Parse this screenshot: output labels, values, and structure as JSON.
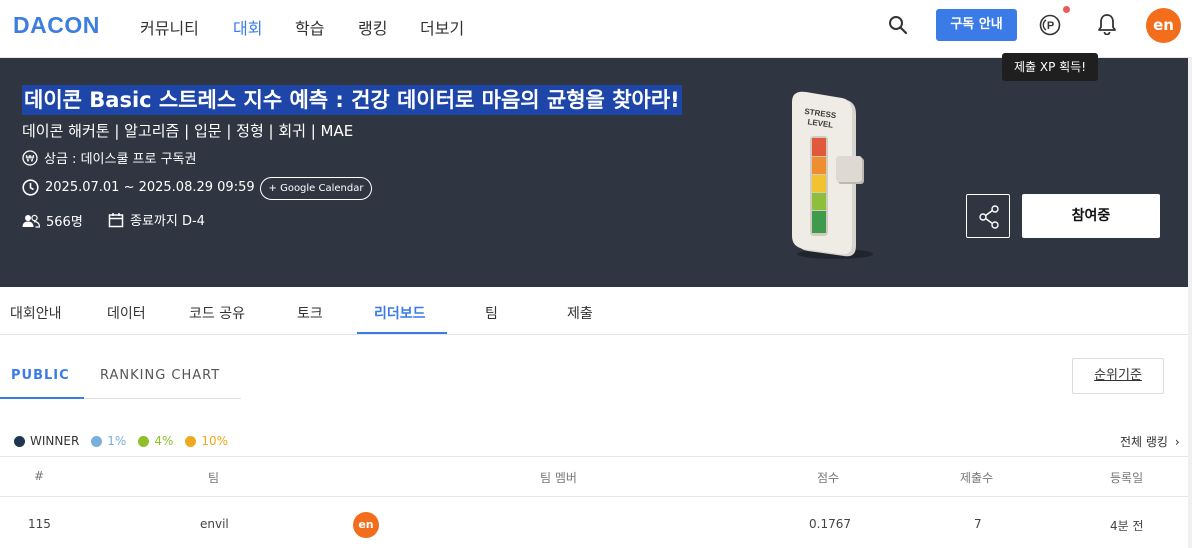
{
  "brand": {
    "logo": "DACON"
  },
  "nav": {
    "items": [
      {
        "label": "커뮤니티",
        "active": false
      },
      {
        "label": "대회",
        "active": true
      },
      {
        "label": "학습",
        "active": false
      },
      {
        "label": "랭킹",
        "active": false
      },
      {
        "label": "더보기",
        "active": false
      }
    ],
    "subscribe_label": "구독 안내",
    "avatar_text": "en",
    "tooltip": "제출 XP 획득!"
  },
  "hero": {
    "title": "데이콘 Basic 스트레스 지수 예측 : 건강 데이터로 마음의 균형을 찾아라!",
    "tags": "데이콘 해커톤 | 알고리즘 | 입문 | 정형 | 회귀 | MAE",
    "prize": "상금 : 데이스쿨 프로 구독권",
    "period": "2025.07.01 ~ 2025.08.29 09:59",
    "calendar_button": "+ Google Calendar",
    "participants": "566명",
    "deadline": "종료까지 D-4",
    "image_label_1": "STRESS",
    "image_label_2": "LEVEL",
    "join_label": "참여중"
  },
  "tabs": [
    {
      "label": "대회안내",
      "active": false
    },
    {
      "label": "데이터",
      "active": false
    },
    {
      "label": "코드 공유",
      "active": false
    },
    {
      "label": "토크",
      "active": false
    },
    {
      "label": "리더보드",
      "active": true
    },
    {
      "label": "팀",
      "active": false
    },
    {
      "label": "제출",
      "active": false
    }
  ],
  "leaderboard": {
    "subtabs": [
      {
        "label": "PUBLIC",
        "active": true
      },
      {
        "label": "RANKING CHART",
        "active": false
      }
    ],
    "criteria_button": "순위기준",
    "legend": [
      {
        "label": "WINNER",
        "color": "#1f3550"
      },
      {
        "label": "1%",
        "color": "#7aaedb"
      },
      {
        "label": "4%",
        "color": "#8fbf2a"
      },
      {
        "label": "10%",
        "color": "#f0a81c"
      }
    ],
    "all_ranking": "전체 랭킹",
    "columns": [
      "#",
      "팀",
      "팀 멤버",
      "점수",
      "제출수",
      "등록일"
    ],
    "rows": [
      {
        "rank": "115",
        "team": "envil",
        "member_avatar": "en",
        "score": "0.1767",
        "submissions": "7",
        "registered": "4분 전"
      }
    ]
  }
}
